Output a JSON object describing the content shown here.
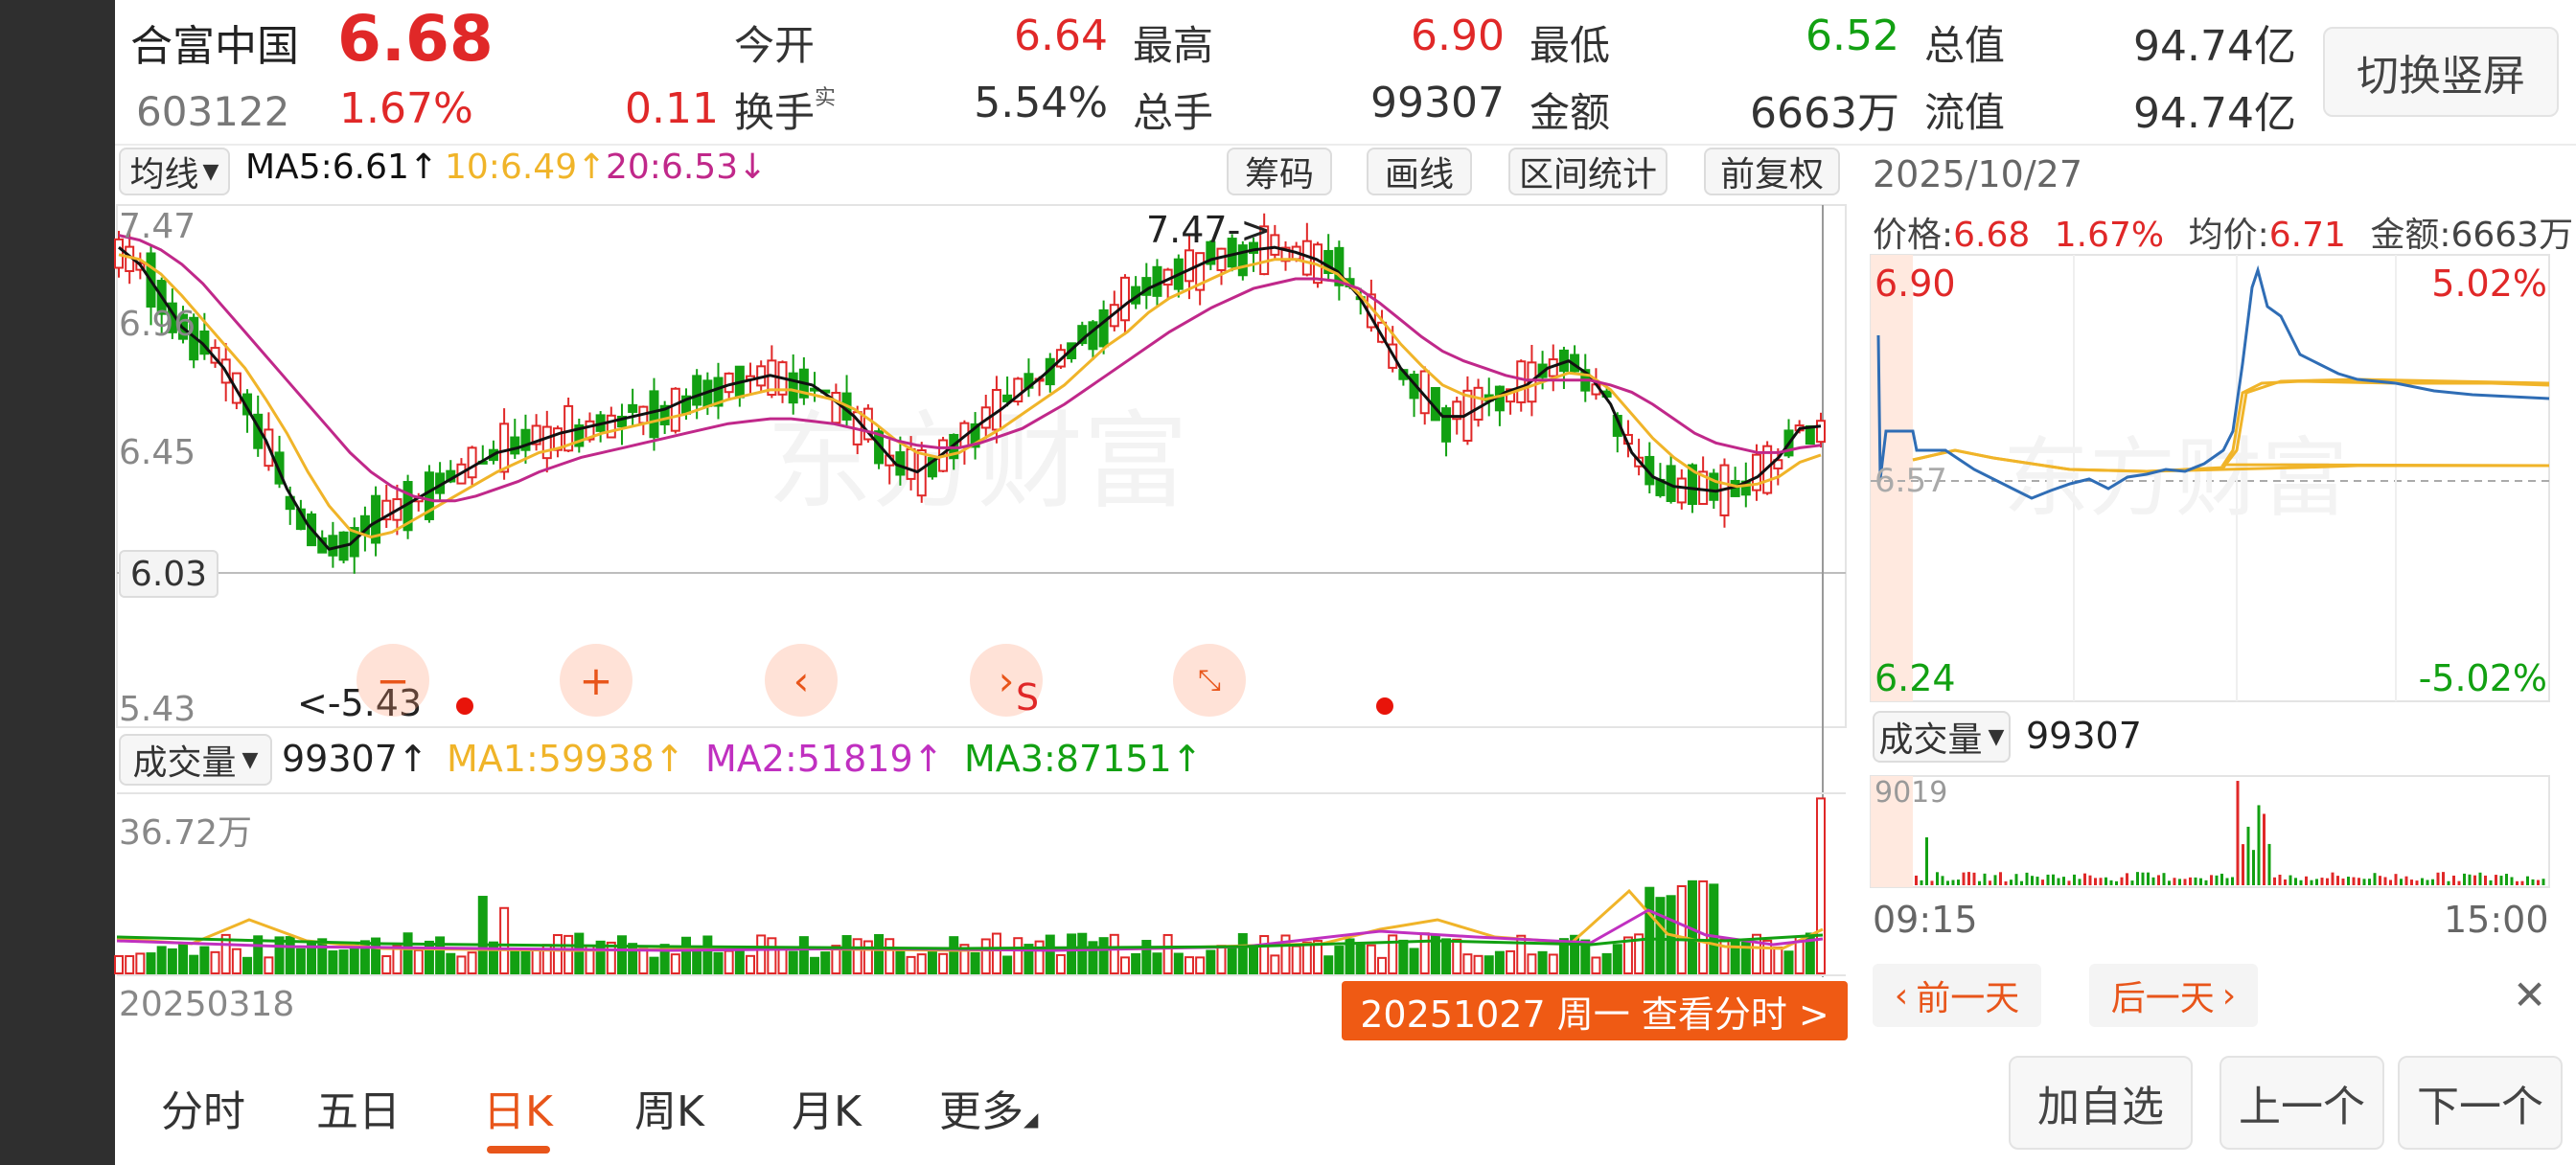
{
  "stock": {
    "name": "合富中国",
    "price": "6.68",
    "code": "603122",
    "pct": "1.67%",
    "change": "0.11"
  },
  "quote": {
    "open_label": "今开",
    "open_value": "6.64",
    "high_label": "最高",
    "high_value": "6.90",
    "low_label": "最低",
    "low_value": "6.52",
    "total_value_label": "总值",
    "total_value_value": "94.74亿",
    "turnover_label": "换手",
    "turnover_sup": "实",
    "turnover_value": "5.54%",
    "total_hands_label": "总手",
    "total_hands_value": "99307",
    "amount_label": "金额",
    "amount_value": "6663万",
    "float_value_label": "流值",
    "float_value_value": "94.74亿"
  },
  "switch_button": "切换竖屏",
  "toolbar": {
    "ma_dropdown": "均线",
    "ma5": "MA5:6.61↑",
    "ma10": "10:6.49↑",
    "ma20": "20:6.53↓",
    "chips": "筹码",
    "draw": "画线",
    "range_stats": "区间统计",
    "adjust": "前复权"
  },
  "kline": {
    "y_top": "7.47",
    "y_2": "6.96",
    "y_3": "6.45",
    "y_bottom": "5.43",
    "crosshair_value": "6.03",
    "max_marker": "7.47->",
    "min_marker": "<-5.43",
    "start_date": "20250318",
    "signal_label": "S"
  },
  "volume": {
    "dropdown": "成交量",
    "value": "99307↑",
    "ma1": "MA1:59938↑",
    "ma2": "MA2:51819↑",
    "ma3": "MA3:87151↑",
    "y_top": "36.72万"
  },
  "tip": "20251027 周一 查看分时 >",
  "intraday": {
    "date": "2025/10/27",
    "price_text": "价格:",
    "price": "6.68",
    "pct": "1.67%",
    "avg_text": "均价:",
    "avg": "6.71",
    "amount_text": "金额:6663万",
    "y_high": "6.90",
    "y_mid": "6.57",
    "y_low": "6.24",
    "pct_high": "5.02%",
    "pct_low": "-5.02%",
    "vol_dropdown": "成交量",
    "vol_value": "99307",
    "vol_top": "9019",
    "time_start": "09:15",
    "time_end": "15:00",
    "prev_day": "前一天",
    "next_day": "后一天",
    "close_icon": "close-icon"
  },
  "tabs": [
    "分时",
    "五日",
    "日K",
    "周K",
    "月K",
    "更多"
  ],
  "bottom_buttons": {
    "add": "加自选",
    "prev": "上一个",
    "next": "下一个"
  },
  "watermark": "东方财富",
  "colors": {
    "up": "#e02828",
    "down": "#12a012",
    "accent": "#e8551a",
    "ma5": "#111111",
    "ma10": "#f0b429",
    "ma20": "#c0288a",
    "intraday_price": "#2f6db5",
    "intraday_avg": "#f0b429"
  },
  "chart_data": {
    "type": "candlestick",
    "ylim": [
      5.43,
      7.47
    ],
    "series": [
      {
        "name": "MA5",
        "values": [
          7.35,
          7.28,
          7.15,
          7.02,
          6.95,
          6.85,
          6.7,
          6.55,
          6.35,
          6.2,
          6.1,
          6.12,
          6.2,
          6.25,
          6.3,
          6.35,
          6.4,
          6.45,
          6.5,
          6.52,
          6.55,
          6.58,
          6.6,
          6.62,
          6.64,
          6.66,
          6.68,
          6.72,
          6.75,
          6.78,
          6.8,
          6.82,
          6.8,
          6.78,
          6.72,
          6.65,
          6.55,
          6.45,
          6.42,
          6.48,
          6.55,
          6.62,
          6.68,
          6.75,
          6.82,
          6.9,
          6.98,
          7.05,
          7.12,
          7.18,
          7.22,
          7.26,
          7.3,
          7.32,
          7.34,
          7.35,
          7.33,
          7.3,
          7.25,
          7.15,
          7.0,
          6.85,
          6.75,
          6.65,
          6.65,
          6.7,
          6.75,
          6.78,
          6.85,
          6.88,
          6.82,
          6.7,
          6.5,
          6.4,
          6.36,
          6.35,
          6.34,
          6.36,
          6.4,
          6.48,
          6.6,
          6.61
        ]
      },
      {
        "name": "MA10",
        "values": [
          7.32,
          7.3,
          7.24,
          7.15,
          7.05,
          6.95,
          6.85,
          6.72,
          6.58,
          6.42,
          6.28,
          6.18,
          6.15,
          6.17,
          6.22,
          6.27,
          6.32,
          6.37,
          6.42,
          6.46,
          6.5,
          6.52,
          6.55,
          6.58,
          6.6,
          6.62,
          6.64,
          6.66,
          6.69,
          6.72,
          6.74,
          6.76,
          6.76,
          6.74,
          6.72,
          6.68,
          6.62,
          6.55,
          6.5,
          6.48,
          6.5,
          6.55,
          6.6,
          6.66,
          6.72,
          6.78,
          6.86,
          6.94,
          7.0,
          7.08,
          7.14,
          7.18,
          7.22,
          7.26,
          7.28,
          7.3,
          7.3,
          7.28,
          7.24,
          7.16,
          7.06,
          6.95,
          6.86,
          6.78,
          6.74,
          6.72,
          6.74,
          6.77,
          6.8,
          6.83,
          6.82,
          6.76,
          6.66,
          6.56,
          6.48,
          6.42,
          6.38,
          6.36,
          6.37,
          6.4,
          6.46,
          6.49
        ]
      },
      {
        "name": "MA20",
        "values": [
          7.4,
          7.38,
          7.34,
          7.28,
          7.2,
          7.1,
          7.0,
          6.9,
          6.8,
          6.7,
          6.6,
          6.5,
          6.42,
          6.36,
          6.32,
          6.3,
          6.3,
          6.32,
          6.35,
          6.38,
          6.42,
          6.45,
          6.48,
          6.5,
          6.52,
          6.54,
          6.56,
          6.58,
          6.6,
          6.62,
          6.63,
          6.64,
          6.64,
          6.63,
          6.62,
          6.6,
          6.58,
          6.55,
          6.53,
          6.52,
          6.52,
          6.54,
          6.57,
          6.6,
          6.65,
          6.7,
          6.76,
          6.82,
          6.88,
          6.94,
          7.0,
          7.05,
          7.1,
          7.14,
          7.18,
          7.2,
          7.22,
          7.22,
          7.21,
          7.18,
          7.12,
          7.05,
          6.98,
          6.92,
          6.88,
          6.85,
          6.82,
          6.8,
          6.8,
          6.8,
          6.8,
          6.78,
          6.75,
          6.7,
          6.64,
          6.58,
          6.54,
          6.52,
          6.5,
          6.5,
          6.52,
          6.53
        ]
      }
    ]
  }
}
